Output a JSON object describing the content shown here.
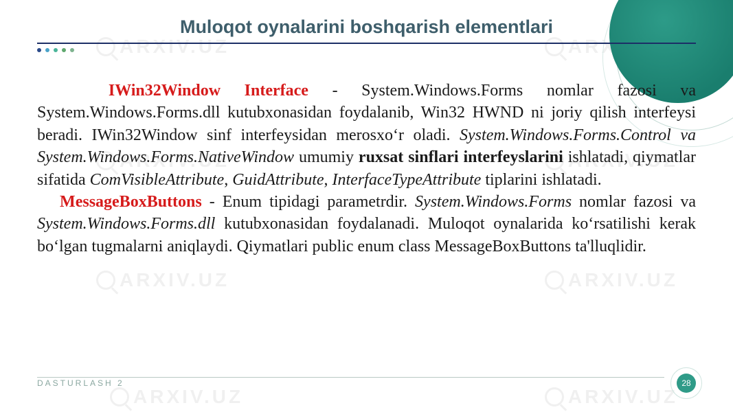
{
  "title": "Muloqot oynalarini boshqarish elementlari",
  "watermark_text": "ARXIV.UZ",
  "para1": {
    "lead": "IWin32Window Interface",
    "seg1": " - System.Windows.Forms nomlar fazosi va System.Windows.Forms.dll kutubxonasidan foydalanib, Win32 HWND ni joriy qilish interfeysi beradi. IWin32Window sinf interfeysidan merosxo‘r oladi. ",
    "italic1": "System.Windows.Forms.Control va System.Windows.Forms.NativeWindow",
    "seg2": " umumiy ",
    "bold1": "ruxsat sinflari interfeyslarini",
    "seg3": " ishlatadi, qiymatlar sifatida ",
    "italic2": "ComVisibleAttribute",
    "comma1": ", ",
    "italic3": "GuidAttribute",
    "comma2": ", ",
    "italic4": "InterfaceTypeAttribute",
    "seg4": " tiplarini ishlatadi."
  },
  "para2": {
    "lead": "MessageBoxButtons",
    "seg1": " -  Enum tipidagi parametrdir. ",
    "italic1": "System.Windows.Forms",
    "seg2": " nomlar fazosi va ",
    "italic2": "System.Windows.Forms.dll",
    "seg3": " kutubxonasidan foydalanadi. Muloqot oynalarida ko‘rsatilishi kerak bo‘lgan tugmalarni aniqlaydi. Qiymatlari public enum class MessageBoxButtons  ta'lluqlidir."
  },
  "footer": {
    "label": "DASTURLASH 2",
    "page": "28"
  }
}
